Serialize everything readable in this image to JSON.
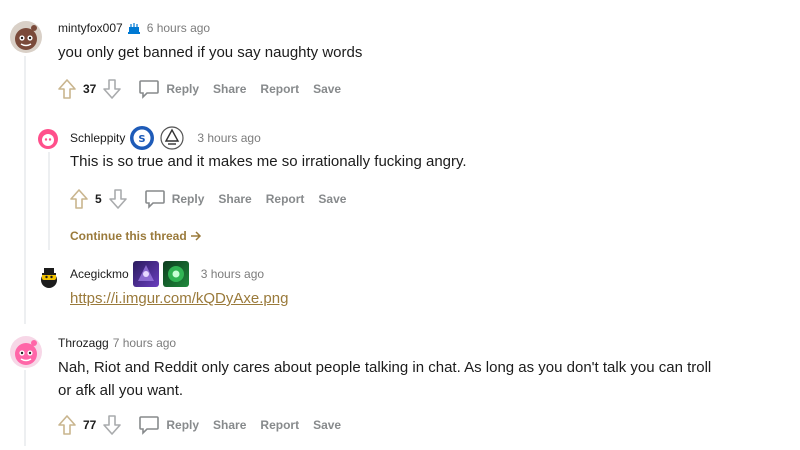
{
  "comments": [
    {
      "username": "mintyfox007",
      "time": "6 hours ago",
      "text": "you only get banned if you say naughty words",
      "score": "37"
    },
    {
      "username": "Schleppity",
      "time": "3 hours ago",
      "text": "This is so true and it makes me so irrationally fucking angry.",
      "score": "5"
    },
    {
      "username": "Acegickmo",
      "time": "3 hours ago",
      "link": "https://i.imgur.com/kQDyAxe.png"
    },
    {
      "username": "Throzagg",
      "time": "7 hours ago",
      "text_line1": "Nah, Riot and Reddit only cares about people talking in chat. As long as you don't talk you can troll",
      "text_line2": "or afk all you want.",
      "score": "77"
    }
  ],
  "actions": {
    "reply": "Reply",
    "share": "Share",
    "report": "Report",
    "save": "Save"
  },
  "continue_thread": "Continue this thread",
  "colors": {
    "accent_link": "#9a7a3b",
    "muted": "#878a8c",
    "thread_line": "#edeff1"
  }
}
